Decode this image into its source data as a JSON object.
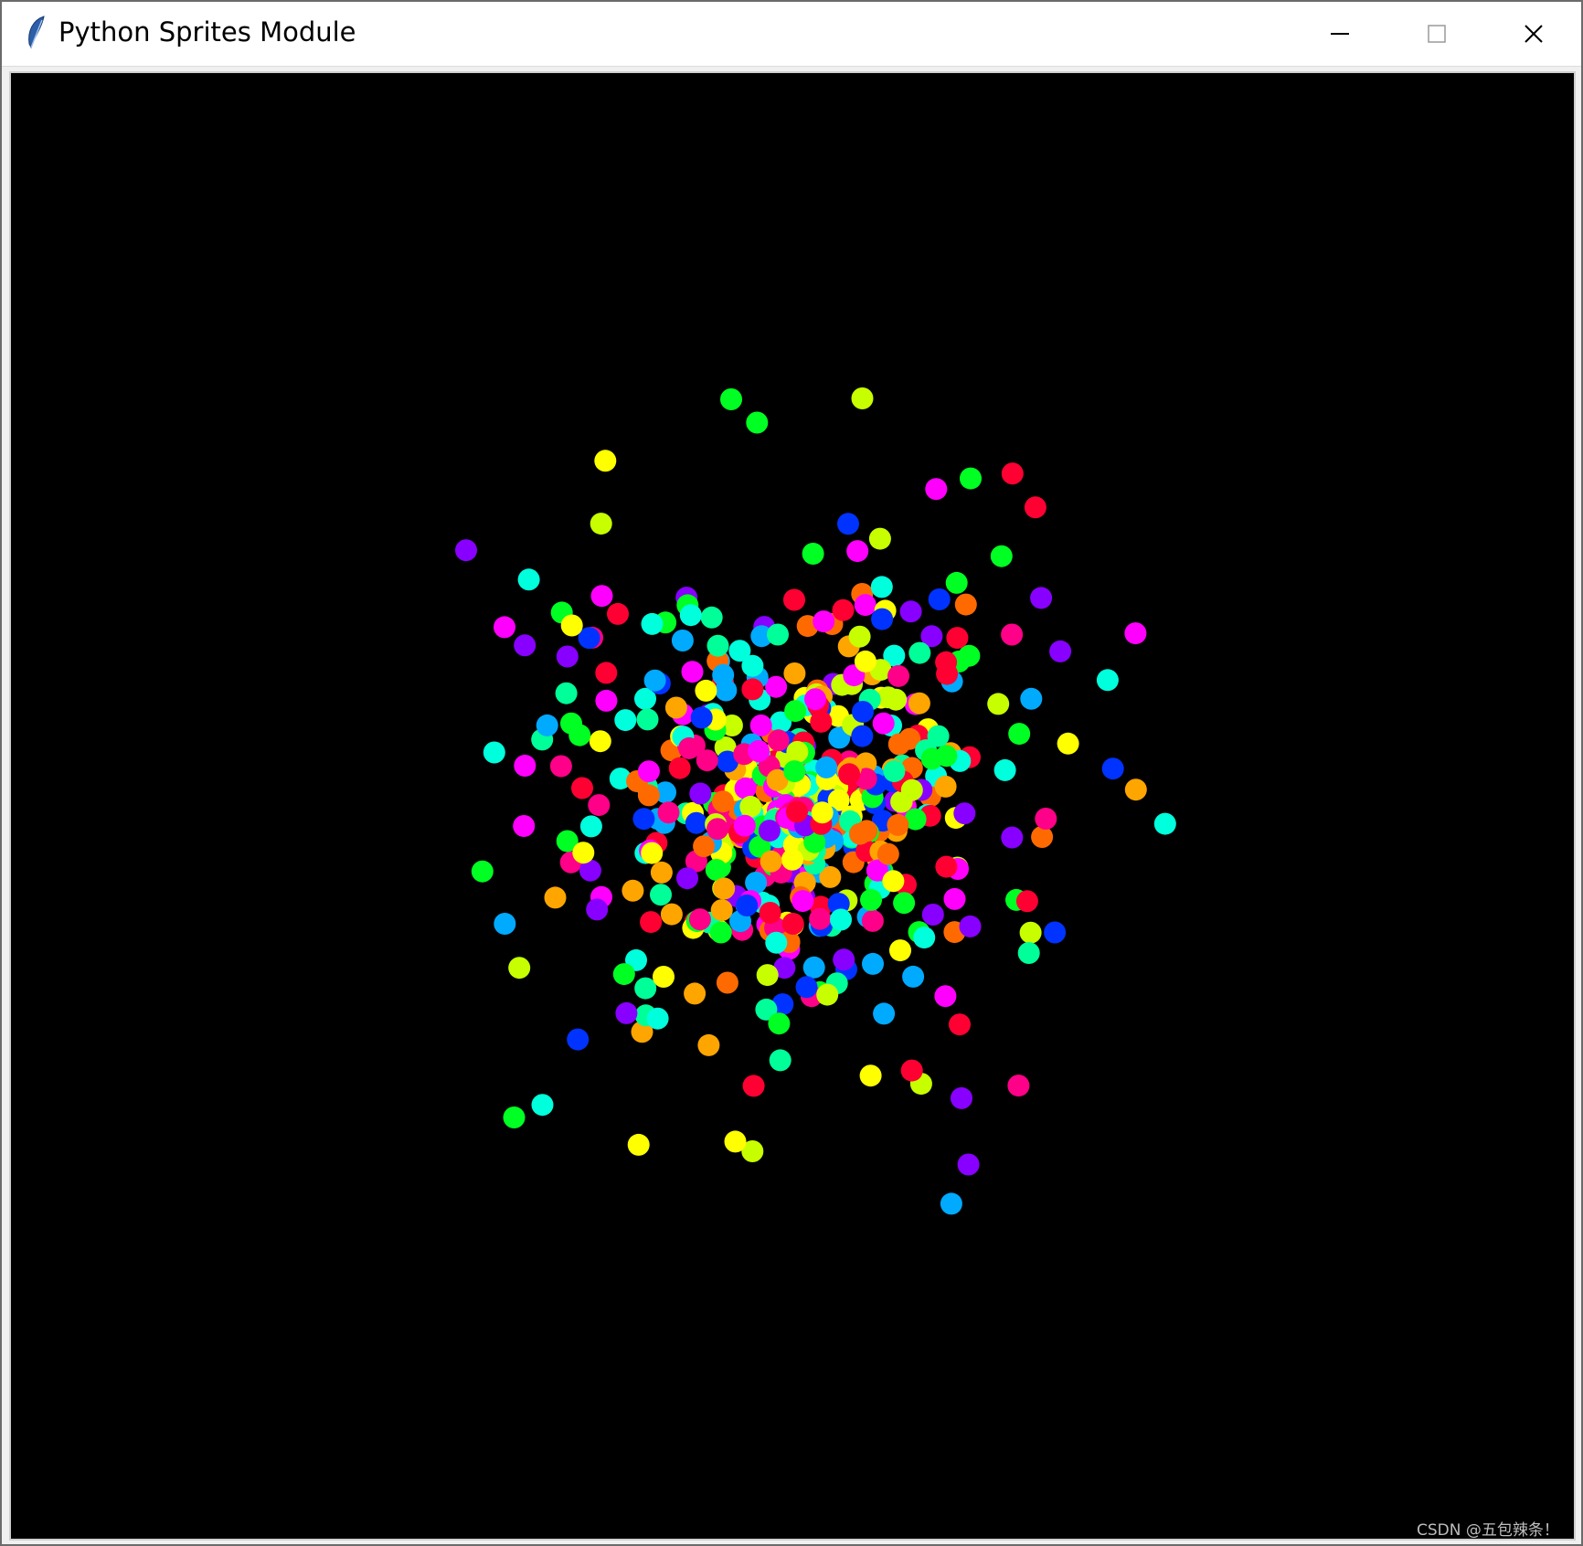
{
  "window": {
    "title": "Python Sprites Module",
    "controls": {
      "minimize_icon": "minimize-icon",
      "maximize_icon": "maximize-icon",
      "close_icon": "close-icon"
    }
  },
  "canvas": {
    "background": "#000000",
    "sprite_colors": [
      "#ff0033",
      "#ff6a00",
      "#ffa500",
      "#ffff00",
      "#c8ff00",
      "#00ff22",
      "#00ff99",
      "#00ffdd",
      "#00aaff",
      "#0033ff",
      "#8800ff",
      "#ff00ff",
      "#ff0088"
    ]
  },
  "watermark": "CSDN @五包辣条！"
}
